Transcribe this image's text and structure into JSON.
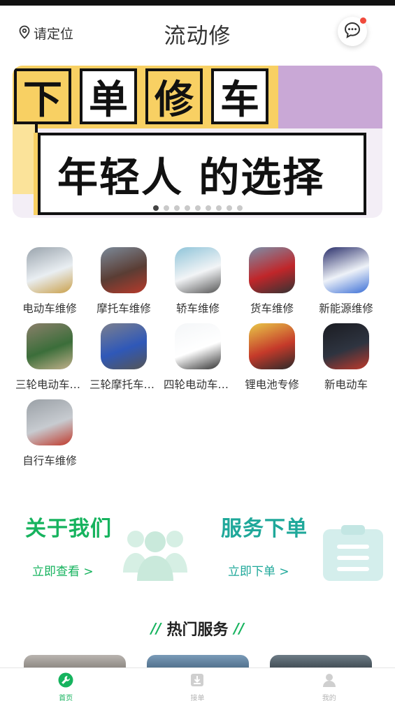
{
  "header": {
    "location_label": "请定位",
    "title": "流动修",
    "message_icon": "chat-bubble-icon"
  },
  "banner": {
    "chars": [
      "下",
      "单",
      "修",
      "车"
    ],
    "main_text": "年轻人 的选择",
    "dot_count": 9,
    "active_dot": 0
  },
  "categories": [
    {
      "label": "电动车维修",
      "icon": "electric-scooter-photo"
    },
    {
      "label": "摩托车维修",
      "icon": "motorcycle-photo"
    },
    {
      "label": "轿车维修",
      "icon": "sedan-photo"
    },
    {
      "label": "货车维修",
      "icon": "truck-photo"
    },
    {
      "label": "新能源维修",
      "icon": "ev-car-photo"
    },
    {
      "label": "三轮电动车维修",
      "icon": "electric-tricycle-photo"
    },
    {
      "label": "三轮摩托车维修",
      "icon": "motor-tricycle-photo"
    },
    {
      "label": "四轮电动车维修",
      "icon": "mini-ev-photo"
    },
    {
      "label": "锂电池专修",
      "icon": "battery-photo"
    },
    {
      "label": "新电动车",
      "icon": "ev-shop-photo"
    },
    {
      "label": "自行车维修",
      "icon": "bicycle-photo"
    }
  ],
  "promos": [
    {
      "title": "关于我们",
      "link": "立即查看 >",
      "icon": "people-icon"
    },
    {
      "title": "服务下单",
      "link": "立即下单 >",
      "icon": "clipboard-icon"
    }
  ],
  "hot_services": {
    "title": "热门服务"
  },
  "tabbar": [
    {
      "label": "首页",
      "icon": "home-wrench-icon",
      "active": true
    },
    {
      "label": "接单",
      "icon": "download-box-icon",
      "active": false
    },
    {
      "label": "我的",
      "icon": "user-icon",
      "active": false
    }
  ],
  "colors": {
    "accent_green": "#16b35e",
    "teal": "#1fa89a",
    "inactive_tab": "#b5b5b5",
    "badge_red": "#f04a3c"
  }
}
